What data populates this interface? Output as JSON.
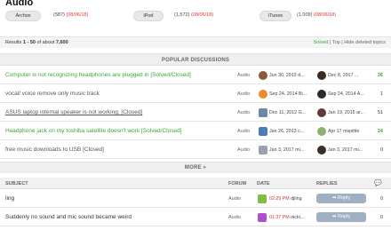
{
  "page": {
    "title": "Audio"
  },
  "filters": [
    {
      "label": "Archos",
      "count": "(587)",
      "date": "(08/06/18)"
    },
    {
      "label": "iPod",
      "count": "(1,572)",
      "date": "(08/06/18)"
    },
    {
      "label": "iTunes",
      "count": "(1,009)",
      "date": "(08/06/18)"
    }
  ],
  "results": {
    "prefix": "Results ",
    "range": "1 - 50",
    "middle": " of about ",
    "total": "7,600",
    "solved": "Solved",
    "sep1": " | ",
    "top": "Top",
    "sep2": " | ",
    "hide": "Hide deleted topics"
  },
  "popular": {
    "heading": "POPULAR DISCUSSIONS",
    "rows": [
      {
        "subject": "Computer is not recognizing headphones are plugged in [Solved/Closed]",
        "style": "green",
        "forum": "Audio",
        "first": "Jun 30, 2013 d...",
        "last": "Dec 8, 2017 ...",
        "replies": "26",
        "av1": "#8b5a3c",
        "av2": "#3b2a22"
      },
      {
        "subject": "vocal/ voice remove only music track",
        "style": "gray",
        "forum": "Audio",
        "first": "Sep 24, 2014 Bi...",
        "last": "Sep 24, 2014 A...",
        "replies": "1",
        "av1": "#f08a2a",
        "av2": "#2b2b2b"
      },
      {
        "subject": "ASUS laptop internal speaker is not working. [Closed]",
        "style": "underline",
        "forum": "Audio",
        "first": "Dec 11, 2012 G...",
        "last": "Jan 19, 2015 ar...",
        "replies": "51",
        "av1": "#6f86a6",
        "av2": "#5b3d36"
      },
      {
        "subject": "Headphone jack on my toshiba satellite doesn't work [Solved/Closed]",
        "style": "green",
        "forum": "Audio",
        "first": "Jan 26, 2013 c...",
        "last": "Apr 17 mspittle",
        "replies": "24",
        "av1": "#4b7dbb",
        "av2": "#8fb070"
      },
      {
        "subject": "free music downloads to USB [Closed]",
        "style": "gray",
        "forum": "Audio",
        "first": "Jan 3, 2017 mi...",
        "last": "Jan 3, 2017 mi...",
        "replies": "0",
        "av1": "#9aa3ad",
        "av2": "#3a2e2a"
      }
    ],
    "more": "MORE »"
  },
  "table": {
    "headers": {
      "subject": "SUBJECT",
      "forum": "FORUM",
      "date": "DATE",
      "replies": "REPLIES"
    },
    "rows": [
      {
        "subject": "ling",
        "forum": "Audio",
        "time": "02:29 PM",
        "user": "djling",
        "reply": "➦ Reply",
        "count": "0",
        "av": "#7fbf3f"
      },
      {
        "subject": "Suddenly no sound and mic sound became weird",
        "forum": "Audio",
        "time": "01:37 PM",
        "user": "nicki...",
        "reply": "➦ Reply",
        "count": "0",
        "av": "#b050c8"
      }
    ]
  }
}
